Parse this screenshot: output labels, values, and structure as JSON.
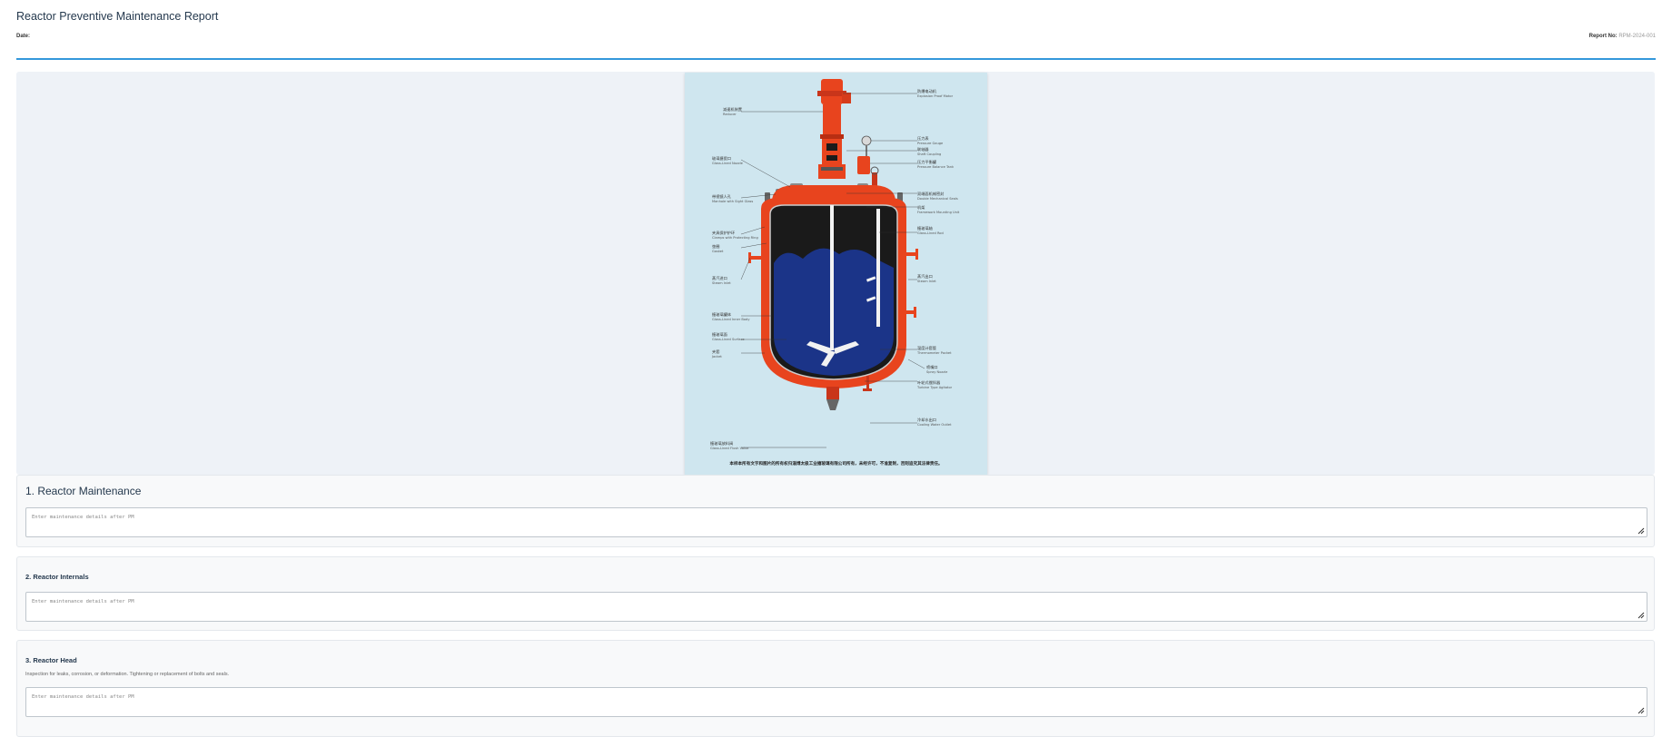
{
  "header": {
    "title": "Reactor Preventive Maintenance Report",
    "date_label": "Date:",
    "report_no_label": "Report No:",
    "report_no_value": "RPM-2024-001"
  },
  "diagram": {
    "labels_left": [
      {
        "zh": "减速机装置",
        "en": "Reducer"
      },
      {
        "zh": "玻璃搪瓷口",
        "en": "Glass-Lined Nozzle"
      },
      {
        "zh": "带视镜人孔",
        "en": "Manhole with Sight Glass"
      },
      {
        "zh": "夹具保护护环",
        "en": "Clamps with Protecting Ring"
      },
      {
        "zh": "垫圈",
        "en": "Gasket"
      },
      {
        "zh": "蒸汽进口",
        "en": "Steam Inlet"
      },
      {
        "zh": "搪玻璃罐体",
        "en": "Glass-Lined Inner Body"
      },
      {
        "zh": "搪玻璃面",
        "en": "Glass-Lined Surface"
      },
      {
        "zh": "夹套",
        "en": "Jacket"
      },
      {
        "zh": "搪玻璃放料阀",
        "en": "Glass-Lined Flush Valve"
      }
    ],
    "labels_right": [
      {
        "zh": "防爆电动机",
        "en": "Explosion Proof Motor"
      },
      {
        "zh": "压力表",
        "en": "Pressure Gauge"
      },
      {
        "zh": "联轴器",
        "en": "Shaft Coupling"
      },
      {
        "zh": "压力平衡罐",
        "en": "Pressure Balance Tank"
      },
      {
        "zh": "双端面机械密封",
        "en": "Double Mechanical Seals"
      },
      {
        "zh": "机架",
        "en": "Framework Mounting Unit"
      },
      {
        "zh": "搪玻璃轴",
        "en": "Glass-Lined Rod"
      },
      {
        "zh": "蒸汽出口",
        "en": "Steam Inlet"
      },
      {
        "zh": "温度计套管",
        "en": "Thermometer Pocket"
      },
      {
        "zh": "喷嘴口",
        "en": "Spray Nozzle"
      },
      {
        "zh": "叶轮式搅拌器",
        "en": "Turbine Type Agitator"
      },
      {
        "zh": "冷却水出口",
        "en": "Cooling Water Outlet"
      }
    ],
    "footer_text": "本样本所有文字和图片的所有权归淄博太极工业搪玻璃有限公司所有，未经许可，不准复制，否则追究其法律责任。"
  },
  "sections": [
    {
      "title": "1. Reactor Maintenance",
      "description": "",
      "placeholder": "Enter maintenance details after PM"
    },
    {
      "title": "2. Reactor Internals",
      "description": "",
      "placeholder": "Enter maintenance details after PM"
    },
    {
      "title": "3. Reactor Head",
      "description": "Inspection for leaks, corrosion, or deformation. Tightening or replacement of bolts and seals.",
      "placeholder": "Enter maintenance details after PM"
    }
  ],
  "colors": {
    "accent_rule": "#3498db",
    "vessel_orange": "#e8441e",
    "vessel_interior": "#1a2a6b",
    "diagram_bg": "#cfe6ef"
  }
}
